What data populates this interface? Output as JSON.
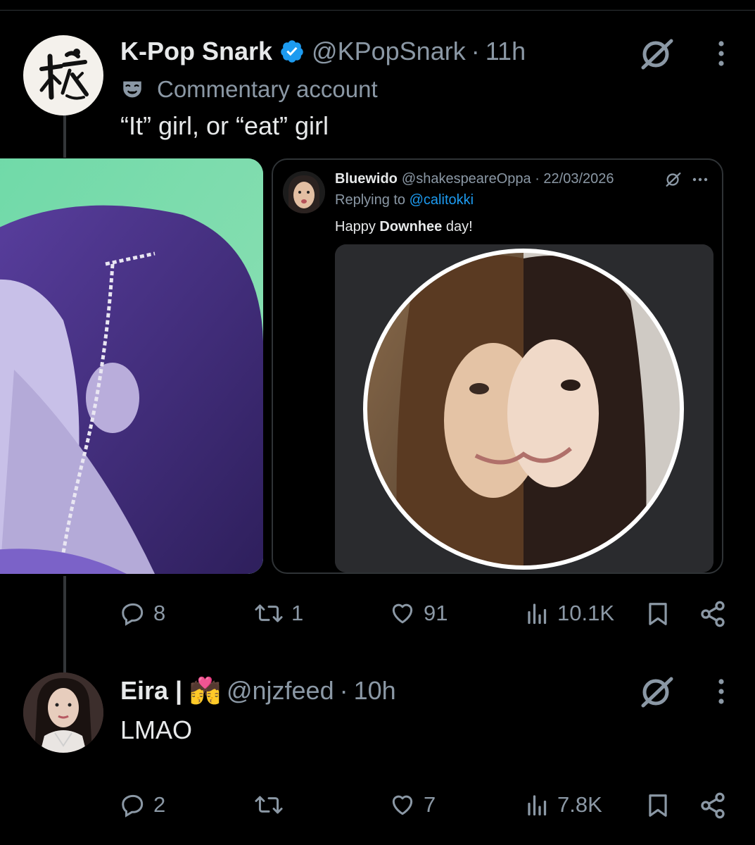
{
  "tweet1": {
    "display_name": "K-Pop Snark",
    "handle": "@KPopSnark",
    "separator": "·",
    "time": "11h",
    "label": "Commentary account",
    "text": "“It” girl, or “eat” girl",
    "quote": {
      "display_name": "Bluewido",
      "handle": "@shakespeareOppa · 22/03/2026",
      "replying_prefix": "Replying to ",
      "replying_to": "@calitokki",
      "text_before": "Happy ",
      "text_bold": "Downhee",
      "text_after": " day!"
    },
    "actions": {
      "replies": "8",
      "reposts": "1",
      "likes": "91",
      "views": "10.1K"
    }
  },
  "tweet2": {
    "display_name": "Eira | 💏",
    "handle": "@njzfeed",
    "separator": "·",
    "time": "10h",
    "text": "LMAO",
    "actions": {
      "replies": "2",
      "reposts": "",
      "likes": "7",
      "views": "7.8K"
    }
  },
  "icons": {
    "reply": "reply-icon",
    "repost": "repost-icon",
    "like": "heart-icon",
    "views": "views-icon",
    "bookmark": "bookmark-icon",
    "share": "share-icon",
    "grok": "grok-icon",
    "more": "more-icon",
    "verified": "verified-badge-icon",
    "commentary": "mask-icon"
  },
  "colors": {
    "background": "#000000",
    "text": "#e7e9ea",
    "muted": "#8b98a5",
    "accent": "#1d9bf0"
  }
}
